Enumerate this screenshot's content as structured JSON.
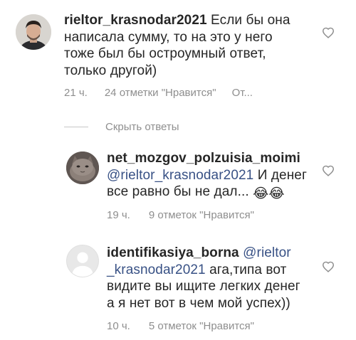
{
  "comments": [
    {
      "username": "rieltor_krasnodar2021",
      "line1_text": " Если бы она",
      "line2": "написала сумму, то на это у него",
      "line3": "тоже был бы остроумный ответ,",
      "line4": "только другой)",
      "time": "21 ч.",
      "likes": "24 отметки \"Нравится\"",
      "reply": "От..."
    },
    {
      "username": "net_mozgov_polzuisia_moimi",
      "mention": "@rieltor_krasnodar2021",
      "line2_text": " И денег",
      "line3": "все равно бы не дал...",
      "emoji": "😂😂",
      "time": "19 ч.",
      "likes": "9 отметок \"Нравится\""
    },
    {
      "username": "identifikasiya_borna",
      "mention_part1": "@rieltor",
      "mention_part2": "_krasnodar2021",
      "line2_text": " ага,типа вот",
      "line3": "видите вы ищите легких денег",
      "line4": "а я нет вот в чем мой успех))",
      "time": "10 ч.",
      "likes": "5 отметок \"Нравится\""
    }
  ],
  "hide_replies_label": "Скрыть ответы",
  "icons": {
    "like": "heart-outline-icon",
    "avatar_default": "default-avatar-icon"
  }
}
